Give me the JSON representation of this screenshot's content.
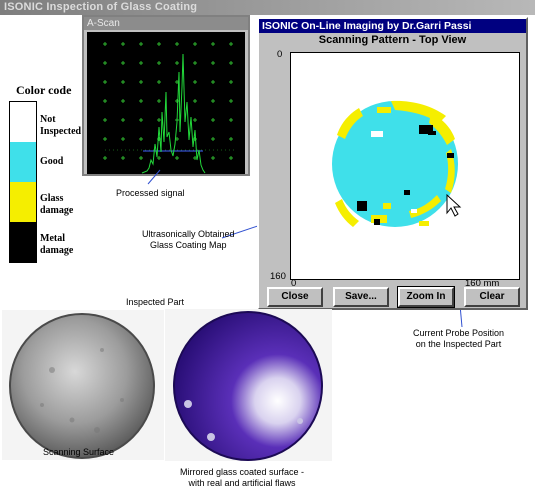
{
  "window_title": "ISONIC Inspection of Glass Coating",
  "ascan": {
    "title": "A-Scan"
  },
  "imaging": {
    "title": "ISONIC On-Line Imaging by Dr.Garri Passi",
    "subtitle": "Scanning Pattern - Top View",
    "y_top_label": "0",
    "y_bottom_label": "160",
    "x_left_label": "0",
    "x_right_label": "160 mm",
    "buttons": {
      "close": "Close",
      "save": "Save...",
      "zoom_in": "Zoom In",
      "clear": "Clear"
    }
  },
  "legend": {
    "title": "Color code",
    "items": [
      {
        "label": "Not Inspected",
        "color": "#ffffff"
      },
      {
        "label": "Good",
        "color": "#3fe0ea"
      },
      {
        "label": "Glass damage",
        "color": "#f5ee00"
      },
      {
        "label": "Metal damage",
        "color": "#000000"
      }
    ]
  },
  "annotations": {
    "processed_signal": "Processed signal",
    "map_caption_line1": "Ultrasonically Obtained",
    "map_caption_line2": "Glass Coating Map",
    "probe_line1": "Current Probe Position",
    "probe_line2": "on the Inspected Part",
    "inspected_part": "Inspected Part",
    "scanning_surface": "Scanning Surface",
    "mirrored_line1": "Mirrored glass coated surface -",
    "mirrored_line2": "with real and artificial flaws"
  },
  "colors": {
    "good": "#3fe0ea",
    "glass_damage": "#f5ee00",
    "metal_damage": "#000000",
    "title_blue": "#000080",
    "signal_green": "#22d83a",
    "grid_green": "#2fb82f"
  }
}
